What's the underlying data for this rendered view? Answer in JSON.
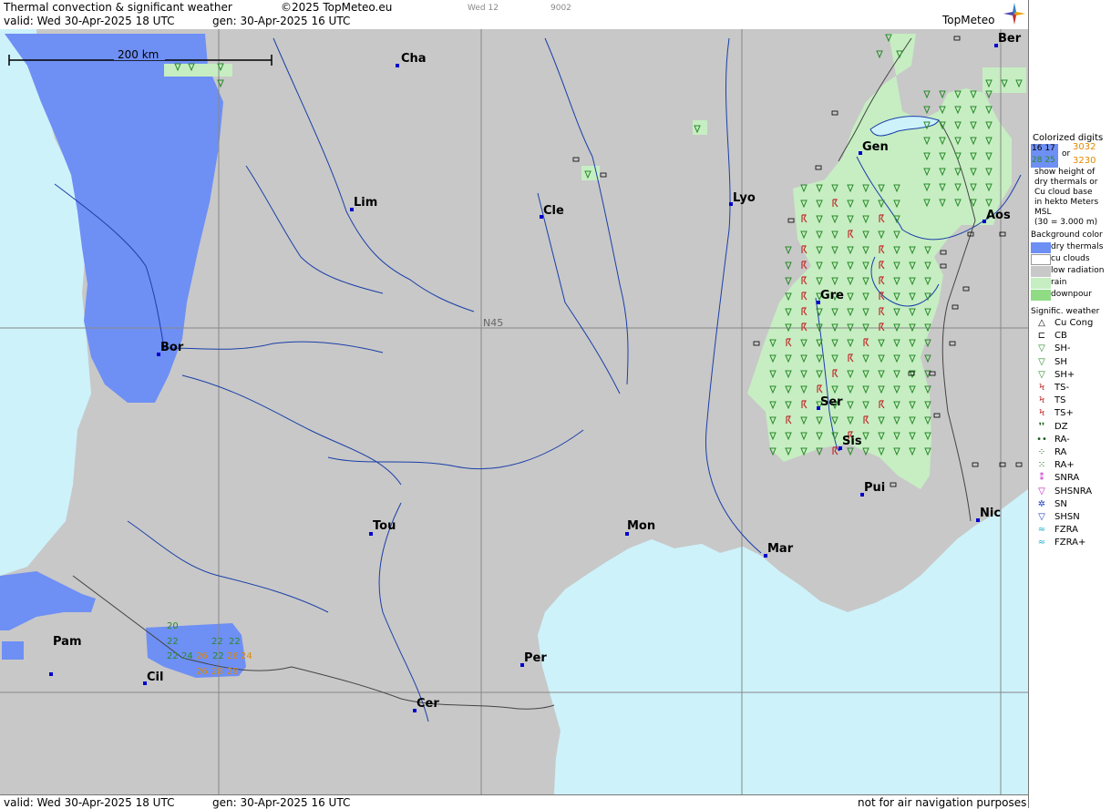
{
  "header": {
    "title": "Thermal convection & significant weather",
    "copyright": "©2025 TopMeteo.eu",
    "day": "Wed 12",
    "code": "9002",
    "valid": "valid:  Wed  30-Apr-2025  18 UTC",
    "gen": "gen: 30-Apr-2025 16 UTC",
    "logo": "TopMeteo"
  },
  "footer": {
    "valid": "valid:  Wed  30-Apr-2025  18 UTC",
    "gen": "gen: 30-Apr-2025 16 UTC",
    "note": "not for air navigation purposes"
  },
  "map": {
    "scale_label": "200 km",
    "parallel_label": "N45",
    "cities": [
      "Cha",
      "Ber",
      "Gen",
      "Lim",
      "Cle",
      "Lyo",
      "Aos",
      "Gre",
      "Bor",
      "Ser",
      "Sis",
      "Pui",
      "Tou",
      "Mon",
      "Nic",
      "Mar",
      "Pam",
      "Cil",
      "Per",
      "Cer"
    ],
    "thermal_digits": [
      "20",
      "22",
      "22",
      "22",
      "22",
      "24",
      "26",
      "26",
      "22",
      "24",
      "26",
      "28",
      "29"
    ],
    "colors": {
      "sea": "#cdf2fa",
      "low_radiation": "#c8c8c8",
      "dry_thermals": "#6e8ff4",
      "rain": "#c6eec2",
      "cities": "#0000cc",
      "rivers": "#1a3fa8"
    }
  },
  "legend": {
    "colorized_title": "Colorized digits",
    "sample_blue_top": "16 17",
    "sample_blue_bottom": "28 25",
    "or": "or",
    "sample_orange_top": "3032",
    "sample_orange_bottom": "3230",
    "desc": [
      "show height of",
      "dry thermals or",
      "Cu cloud base",
      "in hekto Meters",
      "MSL",
      "(30 = 3.000 m)"
    ],
    "bg_title": "Background color",
    "bg_items": [
      {
        "label": "dry thermals",
        "color": "#6e8ff4"
      },
      {
        "label": "cu clouds",
        "color": "#ffffff"
      },
      {
        "label": "low radiation",
        "color": "#c8c8c8"
      },
      {
        "label": "rain",
        "color": "#c6eec2"
      },
      {
        "label": "downpour",
        "color": "#8fdc85"
      }
    ],
    "sig_title": "Signific. weather",
    "sig_items": [
      {
        "label": "Cu Cong",
        "sym": "△"
      },
      {
        "label": "CB",
        "sym": "⊏"
      },
      {
        "label": "SH-",
        "sym": "▽"
      },
      {
        "label": "SH",
        "sym": "▽"
      },
      {
        "label": "SH+",
        "sym": "▽"
      },
      {
        "label": "TS-",
        "sym": "Ϟ"
      },
      {
        "label": "TS",
        "sym": "Ϟ"
      },
      {
        "label": "TS+",
        "sym": "Ϟ"
      },
      {
        "label": "DZ",
        "sym": "❜❜"
      },
      {
        "label": "RA-",
        "sym": "••"
      },
      {
        "label": "RA",
        "sym": "⁘"
      },
      {
        "label": "RA+",
        "sym": "⁙"
      },
      {
        "label": "SNRA",
        "sym": "⁑"
      },
      {
        "label": "SHSNRA",
        "sym": "▽"
      },
      {
        "label": "SN",
        "sym": "✲"
      },
      {
        "label": "SHSN",
        "sym": "▽"
      },
      {
        "label": "FZRA",
        "sym": "≈"
      },
      {
        "label": "FZRA+",
        "sym": "≈"
      }
    ]
  }
}
